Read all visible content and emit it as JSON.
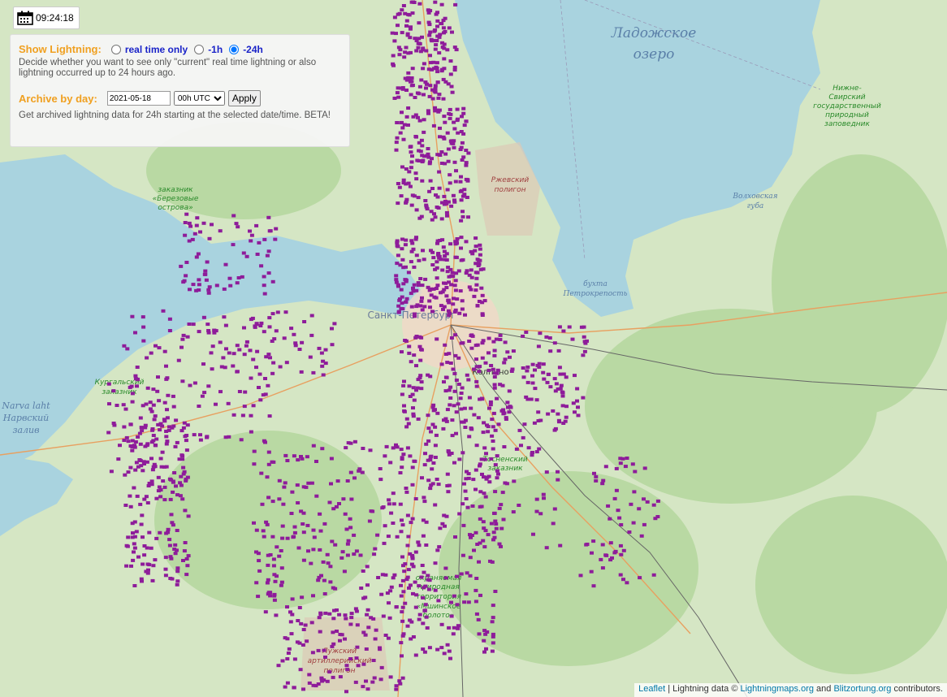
{
  "clock": {
    "time": "09:24:18"
  },
  "controls": {
    "show_label": "Show Lightning:",
    "options": [
      "real time only",
      "-1h",
      "-24h"
    ],
    "selected": "-24h",
    "show_desc": "Decide whether you want to see only \"current\" real time lightning or also lightning occurred up to 24 hours ago.",
    "archive_label": "Archive by day:",
    "date_value": "2021-05-18",
    "time_value": "00h UTC",
    "apply_label": "Apply",
    "archive_desc": "Get archived lightning data for 24h starting at the selected date/time. BETA!"
  },
  "map_labels": {
    "lake": "Ладожское",
    "lake2": "озеро",
    "reserve_nizhne_1": "Нижне-",
    "reserve_nizhne_2": "Свирский",
    "reserve_nizhne_3": "государственный",
    "reserve_nizhne_4": "природный",
    "reserve_nizhne_5": "заповедник",
    "rzhev_1": "Ржевский",
    "rzhev_2": "полигон",
    "volkhov_1": "Волховская",
    "volkhov_2": "губа",
    "petro_1": "бухта",
    "petro_2": "Петрокрепость",
    "spb": "Санкт-Петербург",
    "kolpino": "Колпино",
    "berez_1": "заказник",
    "berez_2": "«Березовые",
    "berez_3": "острова»",
    "kurgal_1": "Кургальский",
    "kurgal_2": "заказник",
    "narva_1": "Narva laht",
    "narva_2": "Нарвский",
    "narva_3": "залив",
    "tosno_1": "Тосненский",
    "tosno_2": "заказник",
    "mshin_1": "охраняемая",
    "mshin_2": "природная",
    "mshin_3": "территория",
    "mshin_4": "«Мшинское",
    "mshin_5": "болото»",
    "luga_1": "Лужский",
    "luga_2": "артиллерийский",
    "luga_3": "полигон"
  },
  "attribution": {
    "leaflet": "Leaflet",
    "sep": " | Lightning data © ",
    "lm": "Lightningmaps.org",
    "and": " and ",
    "bo": "Blitzortung.org",
    "tail": " contributors."
  },
  "colors": {
    "strike": "#8e1c9a",
    "water": "#a9d3df",
    "land": "#d8e8c8",
    "forest": "#b8d8a0"
  }
}
